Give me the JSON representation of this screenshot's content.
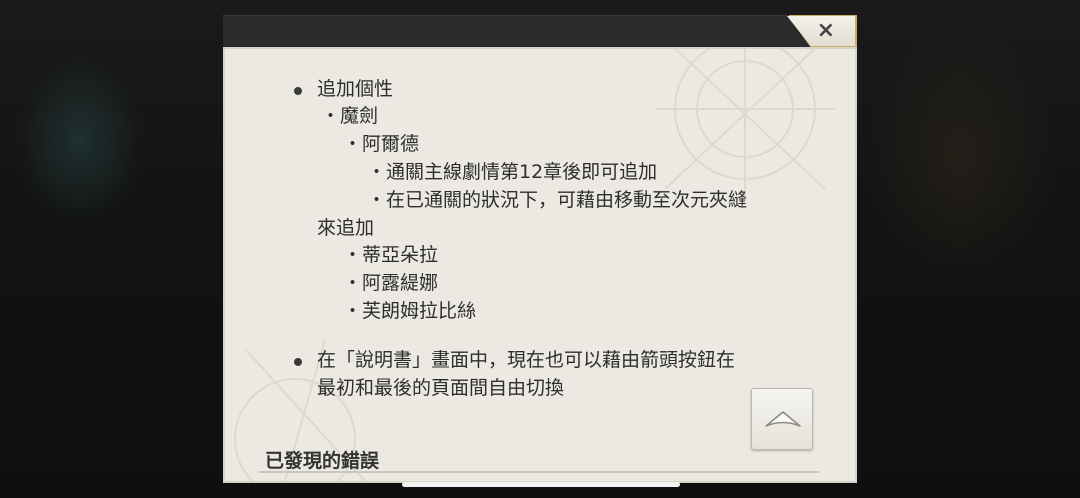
{
  "dialog": {
    "close_label": "×",
    "scroll_top_icon": "chevron-up-icon",
    "colors": {
      "header": "#2b2b2b",
      "panel": "#ebe9e2",
      "text": "#2e2e2e"
    }
  },
  "notes": {
    "bullet1": {
      "title": "追加個性",
      "sub1": "・魔劍",
      "sub2": "・阿爾德",
      "sub3": "・通關主線劇情第12章後即可追加",
      "sub4_line1": "・在已通關的狀況下，可藉由移動至次元夾縫",
      "sub4_line2": "來追加",
      "item_a": "・蒂亞朵拉",
      "item_b": "・阿露緹娜",
      "item_c": "・芙朗姆拉比絲"
    },
    "bullet2": {
      "line1": "在「說明書」畫面中，現在也可以藉由箭頭按鈕在",
      "line2": "最初和最後的頁面間自由切換"
    }
  },
  "section": {
    "heading": "已發現的錯誤"
  }
}
